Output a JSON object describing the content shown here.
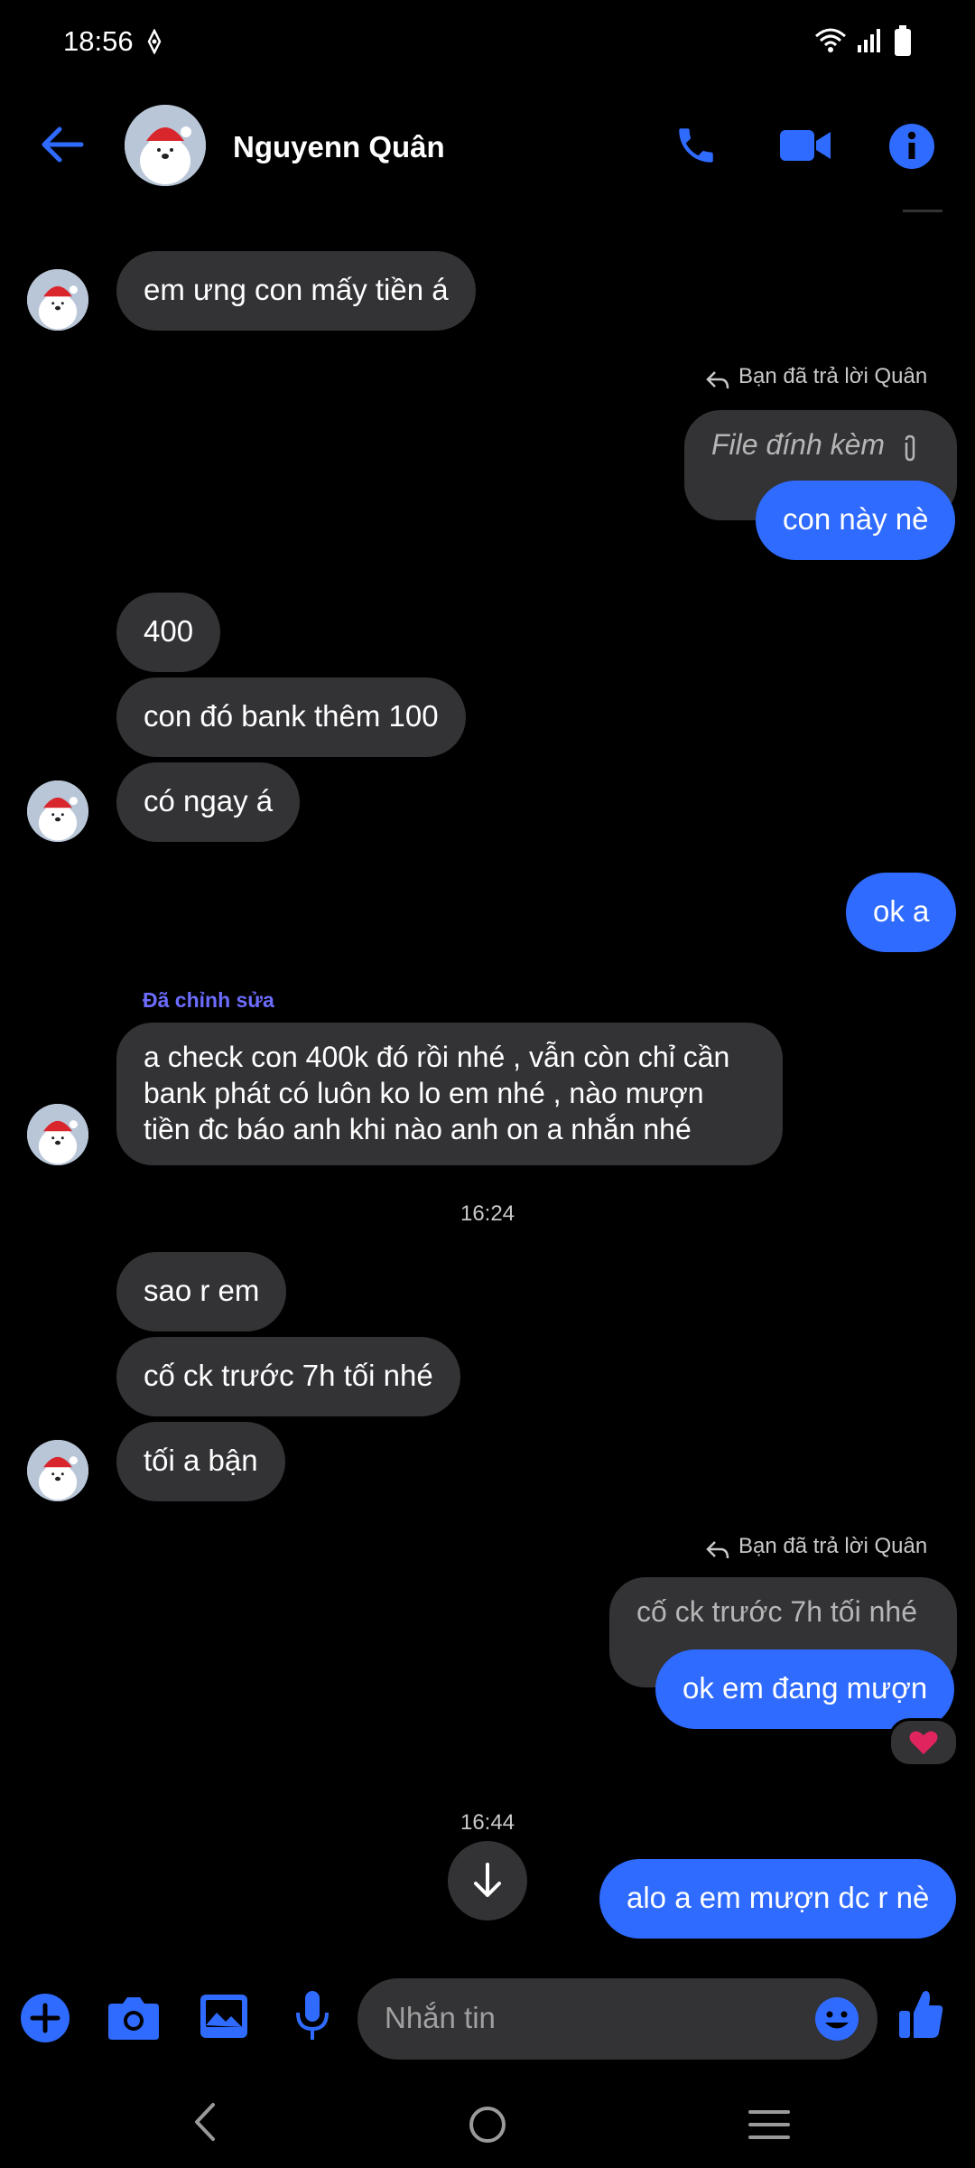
{
  "status": {
    "time": "18:56"
  },
  "header": {
    "contact_name": "Nguyenn Quân"
  },
  "messages": {
    "m1": "em ưng con mấy tiền á",
    "reply1_note": "Bạn đã trả lời Quân",
    "reply1_quote": "File đính kèm",
    "m2": "con này nè",
    "m3": "400",
    "m4": "con đó bank thêm 100",
    "m5": "có ngay á",
    "m6": "ok a",
    "edited_label": "Đã chỉnh sửa",
    "m7": "a check con 400k đó rồi nhé , vẫn còn chỉ cần bank phát có luôn ko lo em nhé , nào mượn tiền đc báo anh khi nào anh on a nhắn nhé",
    "time1": "16:24",
    "m8": "sao r em",
    "m9": "cố ck trước 7h tối nhé",
    "m10": "tối a bận",
    "reply2_note": "Bạn đã trả lời Quân",
    "reply2_quote": "cố ck trước 7h tối nhé",
    "m11": "ok em đang mượn",
    "time2": "16:44",
    "m12": "alo a em mượn dc r nè"
  },
  "composer": {
    "placeholder": "Nhắn tin"
  },
  "colors": {
    "accent": "#2f6bff",
    "bubble_other": "#333336",
    "background": "#000000",
    "reaction": "#e0245e"
  }
}
